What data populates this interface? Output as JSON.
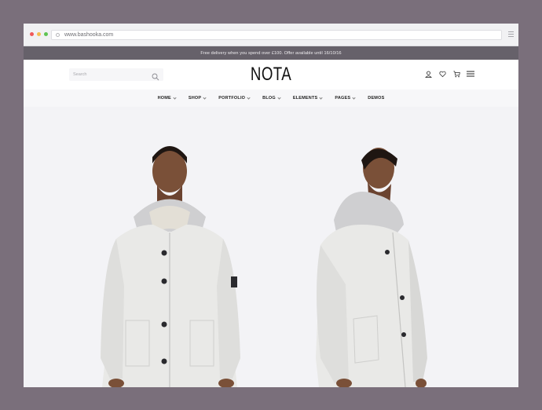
{
  "browser": {
    "url": "www.bashooka.com"
  },
  "announcement": "Free delivery when you spend over £100. Offer available until 16/10/16",
  "header": {
    "search_placeholder": "Search",
    "logo": "NOTA"
  },
  "nav": [
    {
      "label": "HOME",
      "dropdown": true
    },
    {
      "label": "SHOP",
      "dropdown": true
    },
    {
      "label": "PORTFOLIO",
      "dropdown": true
    },
    {
      "label": "BLOG",
      "dropdown": true
    },
    {
      "label": "ELEMENTS",
      "dropdown": true
    },
    {
      "label": "PAGES",
      "dropdown": true
    },
    {
      "label": "DEMOS",
      "dropdown": false
    }
  ],
  "icons": [
    "user-icon",
    "heart-icon",
    "cart-icon",
    "hamburger-menu-icon",
    "search-icon"
  ],
  "colors": {
    "page_bg": "#7a6f7b",
    "announce_bg": "#66616a",
    "hero_bg": "#f3f3f6"
  }
}
